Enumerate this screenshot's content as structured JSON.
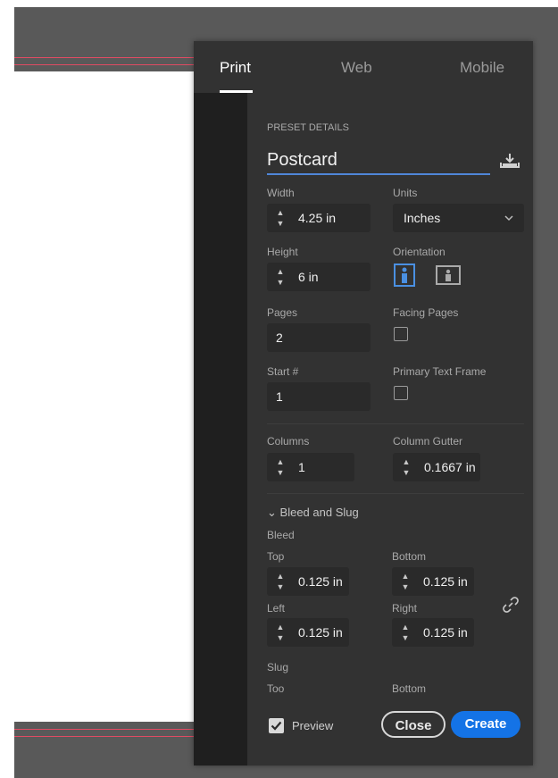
{
  "tabs": [
    {
      "label": "Print",
      "active": true
    },
    {
      "label": "Web",
      "active": false
    },
    {
      "label": "Mobile",
      "active": false
    }
  ],
  "preset": {
    "section_title": "PRESET DETAILS",
    "name": "Postcard",
    "save_icon": "save-preset-icon"
  },
  "size": {
    "width_label": "Width",
    "width_value": "4.25 in",
    "height_label": "Height",
    "height_value": "6 in",
    "units_label": "Units",
    "units_value": "Inches",
    "orientation_label": "Orientation",
    "orientation_selected": "portrait"
  },
  "pages": {
    "pages_label": "Pages",
    "pages_value": "2",
    "facing_label": "Facing Pages",
    "facing_checked": false,
    "start_label": "Start #",
    "start_value": "1",
    "primary_text_label": "Primary Text Frame",
    "primary_text_checked": false
  },
  "columns": {
    "columns_label": "Columns",
    "columns_value": "1",
    "gutter_label": "Column Gutter",
    "gutter_value": "0.1667 in"
  },
  "bleed_slug": {
    "section_label": "Bleed and Slug",
    "bleed_label": "Bleed",
    "top_label": "Top",
    "top_value": "0.125 in",
    "bottom_label": "Bottom",
    "bottom_value": "0.125 in",
    "left_label": "Left",
    "left_value": "0.125 in",
    "right_label": "Right",
    "right_value": "0.125 in",
    "slug_label": "Slug",
    "slug_top_label": "Too",
    "slug_bottom_label": "Bottom"
  },
  "footer": {
    "preview_label": "Preview",
    "preview_checked": true,
    "close_label": "Close",
    "create_label": "Create"
  },
  "colors": {
    "accent": "#1473e6",
    "panel": "#323232",
    "canvas": "#595959",
    "bleed_line": "#e14b63"
  }
}
